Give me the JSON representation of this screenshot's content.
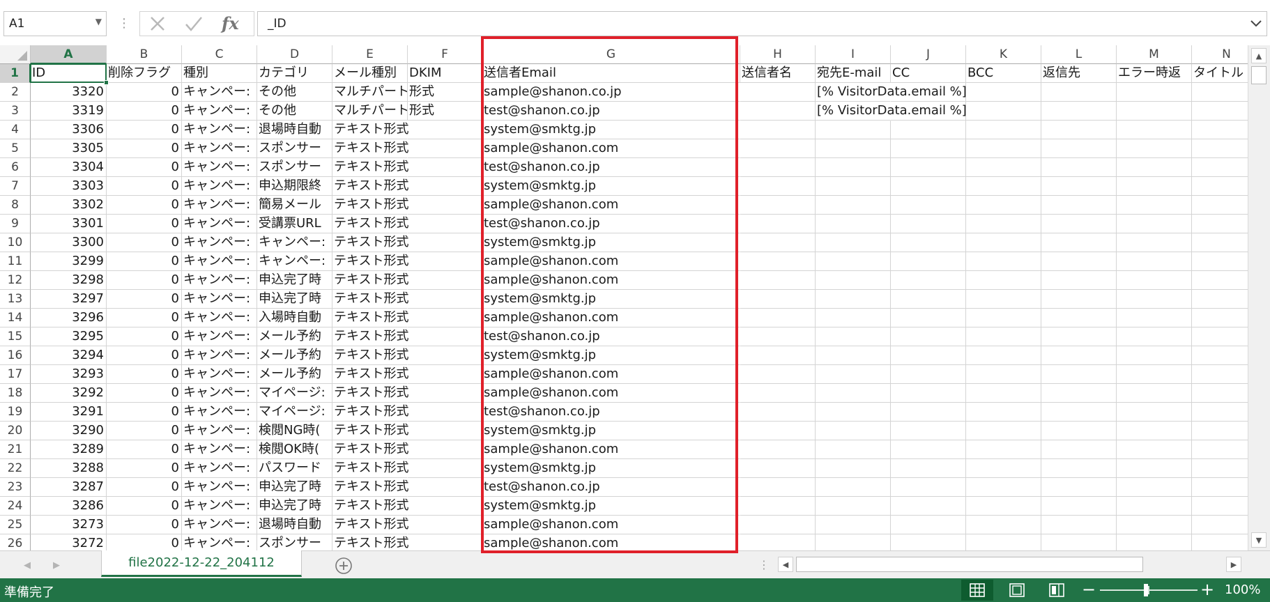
{
  "formula_bar": {
    "name_box": "A1",
    "formula": "_ID",
    "icons": [
      "cancel-icon",
      "enter-icon",
      "insert-function-icon"
    ]
  },
  "columns": [
    "A",
    "B",
    "C",
    "D",
    "E",
    "F",
    "G",
    "H",
    "I",
    "J",
    "K",
    "L",
    "M",
    "N"
  ],
  "selected_column": "A",
  "rows": [
    {
      "n": "1",
      "cells": [
        "ID",
        "削除フラグ",
        "種別",
        "カテゴリ",
        "メール種別",
        "DKIM",
        "送信者Email",
        "送信者名",
        "宛先E-mail",
        "CC",
        "BCC",
        "返信先",
        "エラー時返",
        "タイトル"
      ]
    },
    {
      "n": "2",
      "cells": [
        "3320",
        "0",
        "キャンペー:",
        "その他",
        "マルチパート",
        "形式",
        "sample@shanon.co.jp",
        "",
        "[% VisitorData.email %]",
        "",
        "",
        "",
        "",
        ""
      ]
    },
    {
      "n": "3",
      "cells": [
        "3319",
        "0",
        "キャンペー:",
        "その他",
        "マルチパート",
        "形式",
        "test@shanon.co.jp",
        "",
        "[% VisitorData.email %]",
        "",
        "",
        "",
        "",
        ""
      ]
    },
    {
      "n": "4",
      "cells": [
        "3306",
        "0",
        "キャンペー:",
        "退場時自動",
        "テキスト形式",
        "",
        "system@smktg.jp",
        "",
        "",
        "",
        "",
        "",
        "",
        ""
      ]
    },
    {
      "n": "5",
      "cells": [
        "3305",
        "0",
        "キャンペー:",
        "スポンサー",
        "テキスト形式",
        "",
        "sample@shanon.com",
        "",
        "",
        "",
        "",
        "",
        "",
        ""
      ]
    },
    {
      "n": "6",
      "cells": [
        "3304",
        "0",
        "キャンペー:",
        "スポンサー",
        "テキスト形式",
        "",
        "test@shanon.co.jp",
        "",
        "",
        "",
        "",
        "",
        "",
        ""
      ]
    },
    {
      "n": "7",
      "cells": [
        "3303",
        "0",
        "キャンペー:",
        "申込期限終",
        "テキスト形式",
        "",
        "system@smktg.jp",
        "",
        "",
        "",
        "",
        "",
        "",
        ""
      ]
    },
    {
      "n": "8",
      "cells": [
        "3302",
        "0",
        "キャンペー:",
        "簡易メール",
        "テキスト形式",
        "",
        "sample@shanon.com",
        "",
        "",
        "",
        "",
        "",
        "",
        ""
      ]
    },
    {
      "n": "9",
      "cells": [
        "3301",
        "0",
        "キャンペー:",
        "受講票URL",
        "テキスト形式",
        "",
        "test@shanon.co.jp",
        "",
        "",
        "",
        "",
        "",
        "",
        ""
      ]
    },
    {
      "n": "10",
      "cells": [
        "3300",
        "0",
        "キャンペー:",
        "キャンペー:",
        "テキスト形式",
        "",
        "system@smktg.jp",
        "",
        "",
        "",
        "",
        "",
        "",
        ""
      ]
    },
    {
      "n": "11",
      "cells": [
        "3299",
        "0",
        "キャンペー:",
        "キャンペー:",
        "テキスト形式",
        "",
        "sample@shanon.com",
        "",
        "",
        "",
        "",
        "",
        "",
        ""
      ]
    },
    {
      "n": "12",
      "cells": [
        "3298",
        "0",
        "キャンペー:",
        "申込完了時",
        "テキスト形式",
        "",
        "sample@shanon.com",
        "",
        "",
        "",
        "",
        "",
        "",
        ""
      ]
    },
    {
      "n": "13",
      "cells": [
        "3297",
        "0",
        "キャンペー:",
        "申込完了時",
        "テキスト形式",
        "",
        "system@smktg.jp",
        "",
        "",
        "",
        "",
        "",
        "",
        ""
      ]
    },
    {
      "n": "14",
      "cells": [
        "3296",
        "0",
        "キャンペー:",
        "入場時自動",
        "テキスト形式",
        "",
        "sample@shanon.com",
        "",
        "",
        "",
        "",
        "",
        "",
        ""
      ]
    },
    {
      "n": "15",
      "cells": [
        "3295",
        "0",
        "キャンペー:",
        "メール予約",
        "テキスト形式",
        "",
        "test@shanon.co.jp",
        "",
        "",
        "",
        "",
        "",
        "",
        ""
      ]
    },
    {
      "n": "16",
      "cells": [
        "3294",
        "0",
        "キャンペー:",
        "メール予約",
        "テキスト形式",
        "",
        "system@smktg.jp",
        "",
        "",
        "",
        "",
        "",
        "",
        ""
      ]
    },
    {
      "n": "17",
      "cells": [
        "3293",
        "0",
        "キャンペー:",
        "メール予約",
        "テキスト形式",
        "",
        "sample@shanon.com",
        "",
        "",
        "",
        "",
        "",
        "",
        ""
      ]
    },
    {
      "n": "18",
      "cells": [
        "3292",
        "0",
        "キャンペー:",
        "マイページ:",
        "テキスト形式",
        "",
        "sample@shanon.com",
        "",
        "",
        "",
        "",
        "",
        "",
        ""
      ]
    },
    {
      "n": "19",
      "cells": [
        "3291",
        "0",
        "キャンペー:",
        "マイページ:",
        "テキスト形式",
        "",
        "test@shanon.co.jp",
        "",
        "",
        "",
        "",
        "",
        "",
        ""
      ]
    },
    {
      "n": "20",
      "cells": [
        "3290",
        "0",
        "キャンペー:",
        "検閲NG時(",
        "テキスト形式",
        "",
        "system@smktg.jp",
        "",
        "",
        "",
        "",
        "",
        "",
        ""
      ]
    },
    {
      "n": "21",
      "cells": [
        "3289",
        "0",
        "キャンペー:",
        "検閲OK時(",
        "テキスト形式",
        "",
        "sample@shanon.com",
        "",
        "",
        "",
        "",
        "",
        "",
        ""
      ]
    },
    {
      "n": "22",
      "cells": [
        "3288",
        "0",
        "キャンペー:",
        "パスワード",
        "テキスト形式",
        "",
        "system@smktg.jp",
        "",
        "",
        "",
        "",
        "",
        "",
        ""
      ]
    },
    {
      "n": "23",
      "cells": [
        "3287",
        "0",
        "キャンペー:",
        "申込完了時",
        "テキスト形式",
        "",
        "test@shanon.co.jp",
        "",
        "",
        "",
        "",
        "",
        "",
        ""
      ]
    },
    {
      "n": "24",
      "cells": [
        "3286",
        "0",
        "キャンペー:",
        "申込完了時",
        "テキスト形式",
        "",
        "system@smktg.jp",
        "",
        "",
        "",
        "",
        "",
        "",
        ""
      ]
    },
    {
      "n": "25",
      "cells": [
        "3273",
        "0",
        "キャンペー:",
        "退場時自動",
        "テキスト形式",
        "",
        "sample@shanon.com",
        "",
        "",
        "",
        "",
        "",
        "",
        ""
      ]
    },
    {
      "n": "26",
      "cells": [
        "3272",
        "0",
        "キャンペー:",
        "スポンサー",
        "テキスト形式",
        "",
        "sample@shanon.com",
        "",
        "",
        "",
        "",
        "",
        "",
        ""
      ]
    }
  ],
  "sheet_tab": "file2022-12-22_204112",
  "status": {
    "text": "準備完了",
    "zoom": "100%",
    "zoom_percent": 100
  },
  "colors": {
    "accent": "#217346",
    "highlight_box": "#e0202a"
  }
}
